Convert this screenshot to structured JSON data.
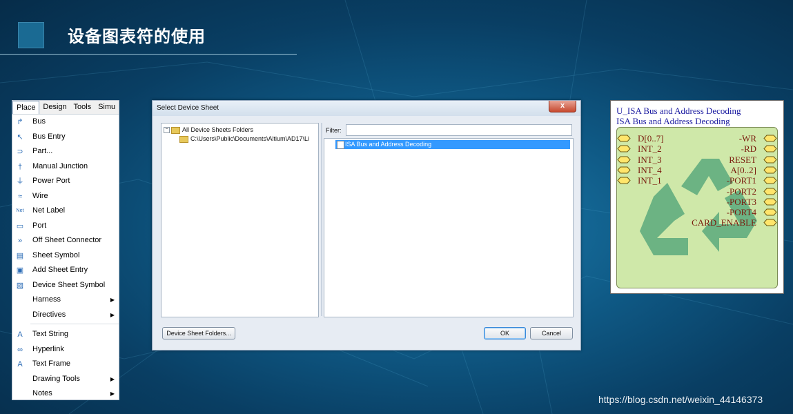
{
  "slide": {
    "title": "设备图表符的使用",
    "watermark": "https://blog.csdn.net/weixin_44146373"
  },
  "place_menu": {
    "menubar": [
      "Place",
      "Design",
      "Tools",
      "Simu"
    ],
    "items": [
      {
        "label": "Bus",
        "icon": "bus-icon",
        "glyph": "↱",
        "submenu": false
      },
      {
        "label": "Bus Entry",
        "icon": "bus-entry-icon",
        "glyph": "↖",
        "submenu": false
      },
      {
        "label": "Part...",
        "icon": "part-icon",
        "glyph": "⊃",
        "submenu": false
      },
      {
        "label": "Manual Junction",
        "icon": "junction-icon",
        "glyph": "†",
        "submenu": false
      },
      {
        "label": "Power Port",
        "icon": "power-port-icon",
        "glyph": "⏚",
        "submenu": false
      },
      {
        "label": "Wire",
        "icon": "wire-icon",
        "glyph": "≈",
        "submenu": false
      },
      {
        "label": "Net Label",
        "icon": "net-label-icon",
        "glyph": "Net",
        "submenu": false
      },
      {
        "label": "Port",
        "icon": "port-icon",
        "glyph": "▭",
        "submenu": false
      },
      {
        "label": "Off Sheet Connector",
        "icon": "off-sheet-connector-icon",
        "glyph": "»",
        "submenu": false
      },
      {
        "label": "Sheet Symbol",
        "icon": "sheet-symbol-icon",
        "glyph": "▤",
        "submenu": false
      },
      {
        "label": "Add Sheet Entry",
        "icon": "add-sheet-entry-icon",
        "glyph": "▣",
        "submenu": false
      },
      {
        "label": "Device Sheet Symbol",
        "icon": "device-sheet-symbol-icon",
        "glyph": "▨",
        "submenu": false
      },
      {
        "label": "Harness",
        "icon": "",
        "glyph": "",
        "submenu": true
      },
      {
        "label": "Directives",
        "icon": "",
        "glyph": "",
        "submenu": true,
        "sep_after": true
      },
      {
        "label": "Text String",
        "icon": "text-string-icon",
        "glyph": "A",
        "submenu": false
      },
      {
        "label": "Hyperlink",
        "icon": "hyperlink-icon",
        "glyph": "∞",
        "submenu": false
      },
      {
        "label": "Text Frame",
        "icon": "text-frame-icon",
        "glyph": "A",
        "submenu": false
      },
      {
        "label": "Drawing Tools",
        "icon": "",
        "glyph": "",
        "submenu": true
      },
      {
        "label": "Notes",
        "icon": "",
        "glyph": "",
        "submenu": true
      }
    ]
  },
  "dialog": {
    "title": "Select Device Sheet",
    "close_glyph": "x",
    "tree": {
      "root_label": "All Device Sheets Folders",
      "child_label": "C:\\Users\\Public\\Documents\\Altium\\AD17\\Li"
    },
    "filter_label": "Filter:",
    "filter_value": "",
    "list_items": [
      "ISA Bus and Address Decoding"
    ],
    "folders_button": "Device Sheet Folders...",
    "ok_button": "OK",
    "cancel_button": "Cancel"
  },
  "symbol": {
    "designator": "U_ISA Bus and Address Decoding",
    "name": "ISA Bus and Address Decoding",
    "left_ports": [
      "D[0..7]",
      "INT_2",
      "INT_3",
      "INT_4",
      "INT_1"
    ],
    "right_ports": [
      "-WR",
      "-RD",
      "RESET",
      "A[0..2]",
      "-PORT1",
      "-PORT2",
      "-PORT3",
      "-PORT4",
      "CARD_ENABLE"
    ],
    "fill_color": "#cfe8a9",
    "port_color": "#ffe56b"
  }
}
